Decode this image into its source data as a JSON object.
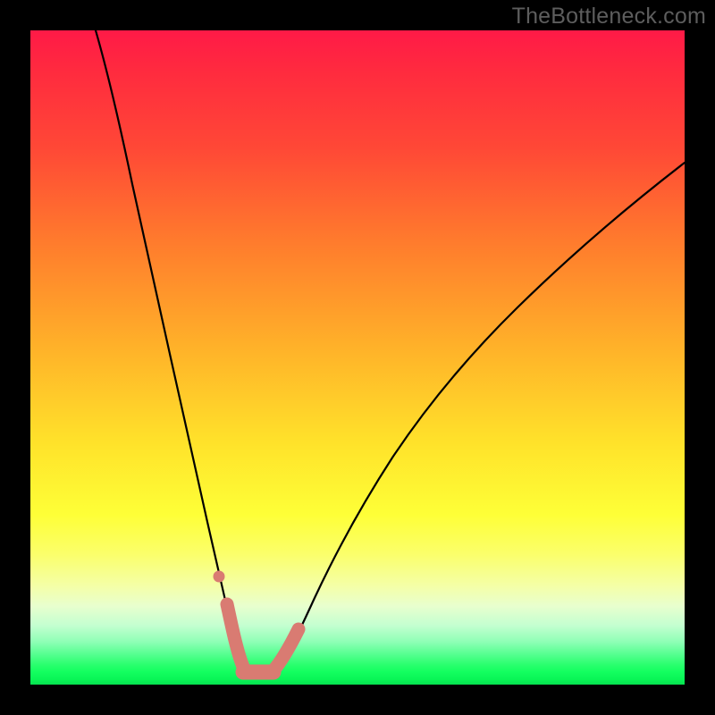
{
  "watermark": {
    "text": "TheBottleneck.com"
  },
  "chart_data": {
    "type": "line",
    "title": "",
    "xlabel": "",
    "ylabel": "",
    "xlim": [
      0,
      100
    ],
    "ylim": [
      0,
      100
    ],
    "grid": false,
    "series": [
      {
        "name": "bottleneck-curve",
        "x": [
          10,
          12,
          14,
          16,
          18,
          20,
          22,
          24,
          26,
          28,
          29,
          30,
          31,
          32,
          33,
          34,
          35,
          36,
          37,
          38,
          40,
          43,
          46,
          50,
          55,
          60,
          65,
          70,
          75,
          80,
          85,
          90,
          95,
          100
        ],
        "values": [
          100,
          92,
          84,
          76,
          67,
          58,
          49,
          40,
          31,
          22,
          17,
          12,
          8,
          5,
          3,
          2,
          2,
          2,
          3,
          4,
          6,
          10,
          15,
          21,
          29,
          36,
          43,
          50,
          56,
          62,
          67,
          72,
          76,
          80
        ]
      }
    ],
    "markers": [
      {
        "name": "left-dot",
        "x": 29.0,
        "y": 17.0
      },
      {
        "name": "bottom-blob",
        "x_range": [
          30.5,
          36.5
        ],
        "y": 2.0
      },
      {
        "name": "right-arm-start",
        "x": 37.5,
        "y": 4.0
      },
      {
        "name": "right-arm-end",
        "x": 40.5,
        "y": 7.0
      }
    ],
    "gradient": {
      "stops": [
        {
          "pos_pct": 0,
          "color": "#ff1a47"
        },
        {
          "pos_pct": 18,
          "color": "#ff4836"
        },
        {
          "pos_pct": 48,
          "color": "#ffb029"
        },
        {
          "pos_pct": 74,
          "color": "#feff37"
        },
        {
          "pos_pct": 91,
          "color": "#c3ffd0"
        },
        {
          "pos_pct": 97,
          "color": "#29ff6d"
        },
        {
          "pos_pct": 100,
          "color": "#06e04f"
        }
      ]
    }
  }
}
